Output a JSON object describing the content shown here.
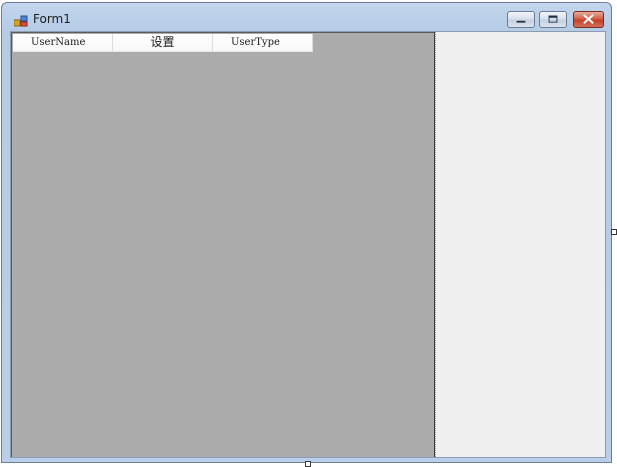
{
  "window": {
    "title": "Form1",
    "icon": "winforms-app-icon",
    "buttons": {
      "minimize_icon": "minimize-icon",
      "maximize_icon": "maximize-icon",
      "close_icon": "close-icon"
    }
  },
  "grid": {
    "columns": [
      {
        "header": "UserName"
      },
      {
        "header": "设置"
      },
      {
        "header": "UserType"
      }
    ],
    "rows": [],
    "background_color": "#ababab"
  },
  "colors": {
    "titlebar": "#b9cee8",
    "client_background": "#f0f0f0",
    "close_button": "#c2402a"
  }
}
